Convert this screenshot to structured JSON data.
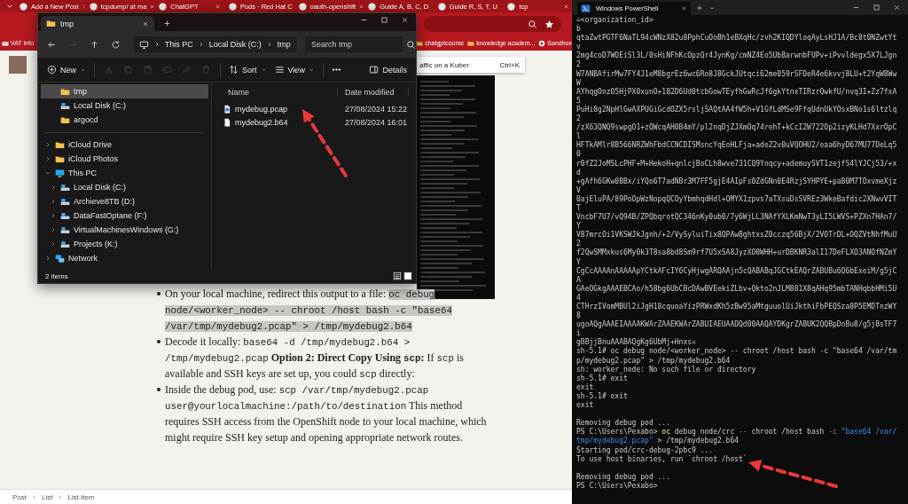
{
  "browser": {
    "tabs": [
      "Add a New Post",
      "tcpdump/ at ma",
      "ChatGPT",
      "Pods · Red Hat C",
      "oauth-openshift",
      "Guide A, B, C, D",
      "Guide R, S, T, U",
      "tcp"
    ],
    "bookmarks": [
      {
        "label": "VAT Info",
        "kind": "mail"
      },
      {
        "label": "chatgptcourse",
        "kind": "folder"
      },
      {
        "label": "knowledge academ...",
        "kind": "folder"
      },
      {
        "label": "Sandbox",
        "kind": "github"
      }
    ],
    "search_suggestion": {
      "text": "affic on a Kuber",
      "shortcut": "Ctrl+K"
    },
    "article": [
      {
        "segments": [
          {
            "kind": "text",
            "text": "On your local machine, redirect this output to a file: "
          },
          {
            "kind": "highlighted-code",
            "text": "oc debug node/<worker_node> -- chroot /host bash -c \"base64 /var/tmp/mydebug2.pcap\" > /tmp/mydebug2.b64"
          }
        ]
      },
      {
        "segments": [
          {
            "kind": "text",
            "text": "Decode it locally: "
          },
          {
            "kind": "code",
            "text": "base64 -d /tmp/mydebug2.b64 > /tmp/mydebug2.pcap"
          },
          {
            "kind": "bold",
            "text": " Option 2: Direct Copy Using "
          },
          {
            "kind": "bold-code",
            "text": "scp"
          },
          {
            "kind": "bold",
            "text": ":"
          },
          {
            "kind": "text",
            "text": " If "
          },
          {
            "kind": "code",
            "text": "scp"
          },
          {
            "kind": "text",
            "text": " is available and SSH keys are set up, you could "
          },
          {
            "kind": "code",
            "text": "scp"
          },
          {
            "kind": "text",
            "text": " directly:"
          }
        ]
      },
      {
        "segments": [
          {
            "kind": "text",
            "text": "Inside the debug pod, use: "
          },
          {
            "kind": "code",
            "text": "scp /var/tmp/mydebug2.pcap user@yourlocalmachine:/path/to/destination"
          },
          {
            "kind": "text",
            "text": " This method requires SSH access from the OpenShift node to your local machine, which might require SSH key setup and opening appropriate network routes."
          }
        ]
      }
    ],
    "breadcrumb": [
      "Post",
      "List",
      "List item"
    ]
  },
  "explorer": {
    "tab_title": "tmp",
    "nav_buttons": [
      {
        "kind": "back",
        "disabled": false
      },
      {
        "kind": "forward",
        "disabled": true
      },
      {
        "kind": "up",
        "disabled": false
      },
      {
        "kind": "refresh",
        "disabled": false
      }
    ],
    "path": [
      "This PC",
      "Local Disk (C:)",
      "tmp"
    ],
    "search": {
      "placeholder": "Search tmp"
    },
    "new_label": "New",
    "actions": [
      {
        "kind": "cut",
        "disabled": true
      },
      {
        "kind": "copy",
        "disabled": true
      },
      {
        "kind": "paste",
        "disabled": true
      },
      {
        "kind": "rename",
        "disabled": true
      },
      {
        "kind": "share",
        "disabled": true
      },
      {
        "kind": "delete",
        "disabled": true
      }
    ],
    "sort_label": "Sort",
    "view_label": "View",
    "details_label": "Details",
    "pinned": [
      {
        "label": "tmp",
        "kind": "folder",
        "selected": true
      },
      {
        "label": "Local Disk (C:)",
        "kind": "drive",
        "selected": false
      },
      {
        "label": "argocd",
        "kind": "folder",
        "selected": false
      }
    ],
    "tree": [
      {
        "label": "iCloud Drive",
        "kind": "folder",
        "selected": false,
        "expanded": false
      },
      {
        "label": "iCloud Photos",
        "kind": "folder",
        "selected": false,
        "expanded": false
      },
      {
        "label": "This PC",
        "kind": "pc",
        "selected": false,
        "expanded": true,
        "children": [
          {
            "label": "Local Disk (C:)",
            "kind": "drive",
            "selected": false,
            "expanded": false
          },
          {
            "label": "Archieve8TB (D:)",
            "kind": "drive",
            "selected": false,
            "expanded": false
          },
          {
            "label": "DataFastOptane (F:)",
            "kind": "drive",
            "selected": false,
            "expanded": false
          },
          {
            "label": "VirtualMachinesWindows (G:)",
            "kind": "drive",
            "selected": false,
            "expanded": false
          },
          {
            "label": "Projects (K:)",
            "kind": "drive",
            "selected": false,
            "expanded": false
          }
        ]
      },
      {
        "label": "Network",
        "kind": "network",
        "selected": false,
        "expanded": false
      }
    ],
    "columns": [
      "Name",
      "Date modified"
    ],
    "files": [
      {
        "name": "mydebug.pcap",
        "kind": "capture",
        "date": "27/08/2024 15:22"
      },
      {
        "name": "mydebug2.b64",
        "kind": "plain",
        "date": "27/08/2024 16:01"
      }
    ],
    "status": "2 items"
  },
  "terminal": {
    "title": "Windows PowerShell",
    "lines": [
      "=<organization_id>",
      "b",
      "qtaZwtPGTF6NaTL94cWNzX82u8PphCuOoBh1eBXqHc/zvh2KIQDYloqAyLsHJ1A/Bc8t0NZwtYt",
      "v",
      "2mg4coD7WOEiSl3L/0sHiNFhKcOpzQr4JynKg/cmNZ4Eo5UbBarwnbFUPv+iPvvldegx5X7LJgn",
      "2",
      "W7ANBAfirMw7FY4J1eM8bgrEz6wc6Ro8J8GckJUtqci62me059rSFDeR4e6kvvj8LU+t2YqW8Ww",
      "W",
      "AYhqgOnzO5HjPX0xunO+182D6Ud0tcbGowTEyfhGwRcJf6gkYtnxTIRzrQwkfU/nvq3I+Zz7fxA",
      "5",
      "PuHi8g2NpHlGwAXPUGiGcdOZX5rsljSAQtAA4fW5h+V1GfLdMSe9FfqUdnUkYOsxBNo1s6ltzlq",
      "2",
      "/zX63QNQ9swpgO1+zQWcqAH0B4mY/pl2nqDjZJXmOq74rehT+kCcI2W722Op2izyKLHd7XxrOpC",
      "l",
      "HFTkAMlr8B566NRZWhFbdCCNCDISMsncYqEoHLFja+adeZ2v0uVQOHU2/eaa6hyD67MU77DeLq5",
      "0",
      "r0fZ2JoMSLcPHF+M+HekoH+qnlcjBoCLh8wve731CQ9Ynqcy+ademuySVT1zejfS4lYJCj53/+x",
      "d",
      "+gAfh6GKw0BBx/iYQo6T7adNBr3M7FF5gjE4AIpFs0ZdGNn0E4RzjSYHPYE+paB0M7TOxvmeXjz",
      "V",
      "0ajEluPA/89PoOpWzNopqQCOyYbmhqdHdl+OMYX1zpvs7aTXsuDsSVREz3WkeBafdic2XNwvVIT",
      "T",
      "VncbF7U7/vQ94B/ZPQbqrotQC346nKy0ub0/7y6WjLL3NAfYXLKmNwT3yLI5LWVS+PZXn7HAn7/",
      "Y",
      "V87mrcOi1VKSWJkJgnh/+2/VySyluiTix8QPAwBghtxsZ0cczq56BjX/2VOTrDL+OQZVtNhfMuU",
      "2",
      "f2QwSMMxkus6My0k3T8sa8bd8Sm9rf7U5xSA8JyzXO0WHH+urDBKNR3alI17DeFLXO3ANOfNZmY",
      "Y",
      "CgCcAAAAnAAAAApYCtkAFcIY6CyHjwgARQAAjn5cQABABqJGCtkEAQrZABUBu6Q6bExeiM/g5jC",
      "A",
      "GAeOGkgAAAEBCAo/h58bg6UbCBcDAwBVEekiZLbv+Qkto2nJLM881X8qAHq95mbTANHqbbHMi5U",
      "4",
      "CTHrzIVomMBUl2iJgH18cquoaYizPRWxdKh5zBw95aMtguuolUiJkthiFbPEQSza8P5EMDTnzWY",
      "8",
      "ugoAQgAAAEIAAAAKWArZAAEKWArZABUIAEUAADQd00AAQAYDKgrZABUK2QQBpDoBu8/g5jBsTF7",
      "i",
      "gBBjjBnuAAABAQgKg6UbMj+Hnxs=",
      "sh-5.1# oc debug node/<worker_node> -- chroot /host bash -c \"base64 /var/tm",
      "p/mydebug2.pcap\" > /tmp/mydebug2.b64",
      "sh: worker_node: No such file or directory",
      "sh-5.1# exit",
      "exit",
      "sh-5.1# exit",
      "exit",
      {
        "kind": "blank"
      },
      "Removing debug pod ...",
      {
        "kind": "segments",
        "segments": [
          {
            "kind": "plain",
            "text": "PS C:\\Users\\Pexabo> "
          },
          {
            "kind": "command",
            "text": "oc"
          },
          {
            "kind": "plain",
            "text": " debug node/crc "
          },
          {
            "kind": "param",
            "text": "--"
          },
          {
            "kind": "plain",
            "text": " chroot /host bash "
          },
          {
            "kind": "param",
            "text": "-c"
          },
          {
            "kind": "string",
            "text": " \"base64 /var/"
          }
        ]
      },
      {
        "kind": "segments",
        "segments": [
          {
            "kind": "string",
            "text": "tmp/mydebug2.pcap\""
          },
          {
            "kind": "plain",
            "text": " > /tmp/mydebug2.b64"
          }
        ]
      },
      "Starting pod/crc-debug-2pbc9 ...",
      "To use host binaries, run `chroot /host`",
      {
        "kind": "blank"
      },
      "Removing debug pod ...",
      "PS C:\\Users\\Pexabo>"
    ]
  }
}
